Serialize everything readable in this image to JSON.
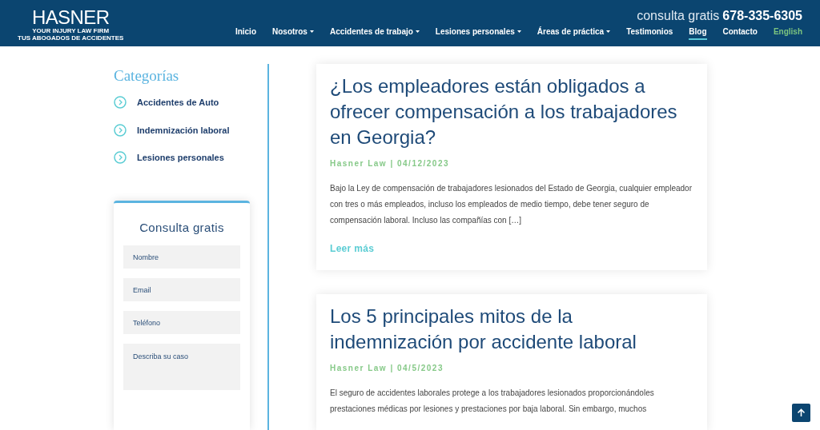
{
  "header": {
    "logo": "HASNER",
    "tagline_1": "YOUR INJURY LAW FIRM",
    "tagline_2": "TUS ABOGADOS DE ACCIDENTES",
    "contact_label": "consulta gratis",
    "phone": "678-335-6305",
    "nav": [
      {
        "label": "Inicio",
        "dropdown": false,
        "selected": false,
        "kind": "link"
      },
      {
        "label": "Nosotros",
        "dropdown": true,
        "selected": false,
        "kind": "link"
      },
      {
        "label": "Accidentes de trabajo",
        "dropdown": true,
        "selected": false,
        "kind": "link"
      },
      {
        "label": "Lesiones personales",
        "dropdown": true,
        "selected": false,
        "kind": "link"
      },
      {
        "label": "Áreas de práctica",
        "dropdown": true,
        "selected": false,
        "kind": "link"
      },
      {
        "label": "Testimonios",
        "dropdown": false,
        "selected": false,
        "kind": "link"
      },
      {
        "label": "Blog",
        "dropdown": false,
        "selected": true,
        "kind": "link"
      },
      {
        "label": "Contacto",
        "dropdown": false,
        "selected": false,
        "kind": "link"
      },
      {
        "label": "English",
        "dropdown": false,
        "selected": false,
        "kind": "language"
      }
    ]
  },
  "sidebar": {
    "title": "Categorías",
    "categories": [
      "Accidentes de Auto",
      "Indemnización laboral",
      "Lesiones personales"
    ],
    "form": {
      "title": "Consulta gratis",
      "fields": [
        {
          "placeholder": "Nombre",
          "kind": "input"
        },
        {
          "placeholder": "Email",
          "kind": "input"
        },
        {
          "placeholder": "Teléfono",
          "kind": "input"
        },
        {
          "placeholder": "Describa su caso",
          "kind": "textarea"
        }
      ]
    }
  },
  "posts": [
    {
      "title": "¿Los empleadores están obligados a ofrecer compensación a los trabajadores en Georgia?",
      "meta": "Hasner Law | 04/12/2023",
      "excerpt": "Bajo la Ley de compensación de trabajadores lesionados del Estado de Georgia, cualquier empleador con tres o más empleados, incluso los empleados de medio tiempo, debe tener seguro de compensación laboral. Incluso las compañías con […]",
      "read_more": "Leer más"
    },
    {
      "title": "Los 5 principales mitos de la indemnización por accidente laboral",
      "meta": "Hasner Law | 04/5/2023",
      "excerpt": "El seguro de accidentes laborales protege a los trabajadores lesionados proporcionándoles prestaciones médicas por lesiones y prestaciones por baja laboral. Sin embargo, muchos"
    }
  ]
}
